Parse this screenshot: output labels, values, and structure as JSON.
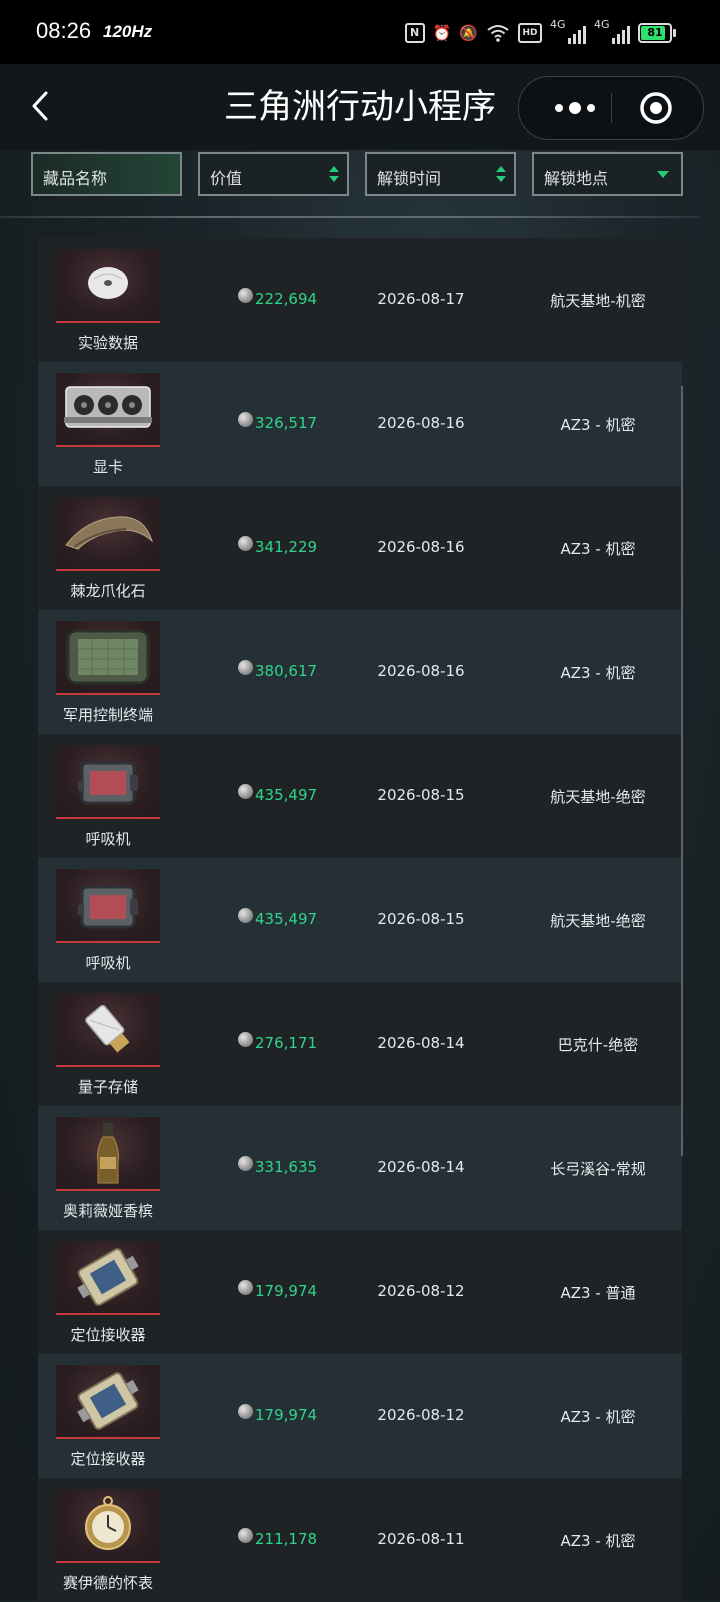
{
  "status_bar": {
    "time": "08:26",
    "refresh_rate": "120Hz",
    "battery": "81",
    "net1": "4G",
    "net2": "4G"
  },
  "nav": {
    "title": "三角洲行动小程序"
  },
  "filters": [
    {
      "label": "藏品名称",
      "control": "none"
    },
    {
      "label": "价值",
      "control": "sort"
    },
    {
      "label": "解锁时间",
      "control": "sort"
    },
    {
      "label": "解锁地点",
      "control": "dropdown"
    }
  ],
  "colors": {
    "value_green": "#2fd58a",
    "accent_green": "#27c97a",
    "row_dark": "#1f2326",
    "row_light": "#252f36",
    "thumb_border": "#c23a3a"
  },
  "items": [
    {
      "name": "实验数据",
      "value": "222,694",
      "date": "2026-08-17",
      "location": "航天基地-机密",
      "icon": "disc-icon"
    },
    {
      "name": "显卡",
      "value": "326,517",
      "date": "2026-08-16",
      "location": "AZ3 - 机密",
      "icon": "gpu-icon"
    },
    {
      "name": "棘龙爪化石",
      "value": "341,229",
      "date": "2026-08-16",
      "location": "AZ3 - 机密",
      "icon": "claw-fossil-icon"
    },
    {
      "name": "军用控制终端",
      "value": "380,617",
      "date": "2026-08-16",
      "location": "AZ3 - 机密",
      "icon": "control-terminal-icon"
    },
    {
      "name": "呼吸机",
      "value": "435,497",
      "date": "2026-08-15",
      "location": "航天基地-绝密",
      "icon": "ventilator-icon"
    },
    {
      "name": "呼吸机",
      "value": "435,497",
      "date": "2026-08-15",
      "location": "航天基地-绝密",
      "icon": "ventilator-icon"
    },
    {
      "name": "量子存储",
      "value": "276,171",
      "date": "2026-08-14",
      "location": "巴克什-绝密",
      "icon": "usb-drive-icon"
    },
    {
      "name": "奥莉薇娅香槟",
      "value": "331,635",
      "date": "2026-08-14",
      "location": "长弓溪谷-常规",
      "icon": "champagne-icon"
    },
    {
      "name": "定位接收器",
      "value": "179,974",
      "date": "2026-08-12",
      "location": "AZ3 - 普通",
      "icon": "gps-receiver-icon"
    },
    {
      "name": "定位接收器",
      "value": "179,974",
      "date": "2026-08-12",
      "location": "AZ3 - 机密",
      "icon": "gps-receiver-icon"
    },
    {
      "name": "赛伊德的怀表",
      "value": "211,178",
      "date": "2026-08-11",
      "location": "AZ3 - 机密",
      "icon": "pocket-watch-icon"
    }
  ]
}
